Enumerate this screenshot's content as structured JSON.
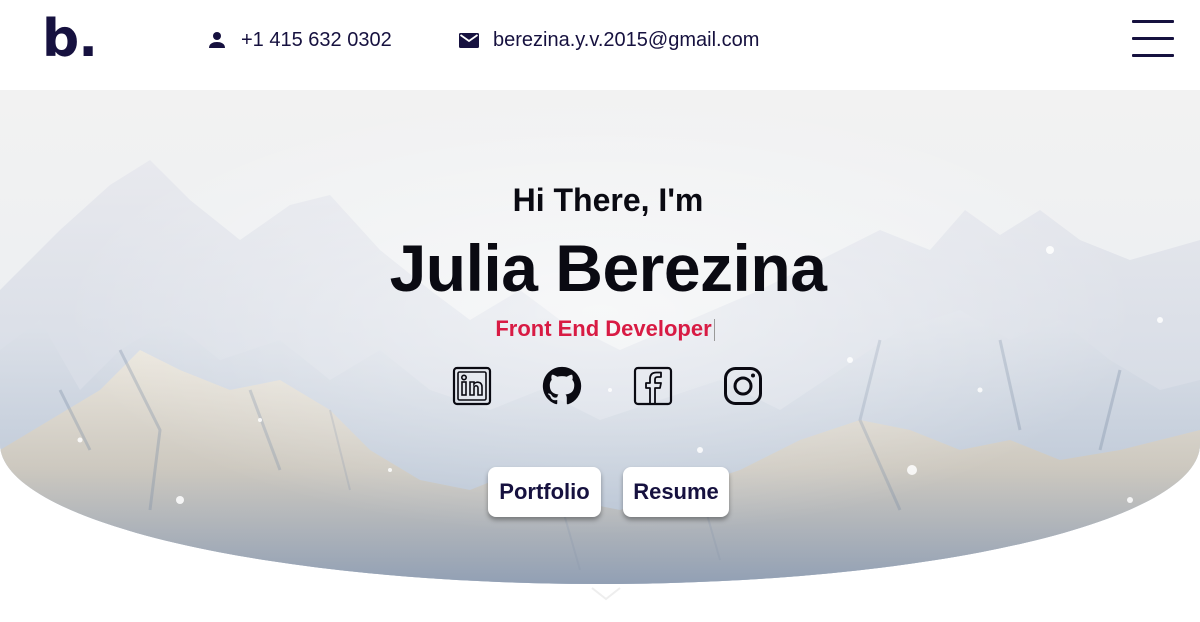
{
  "header": {
    "logo": "b.",
    "phone": {
      "icon": "person-icon",
      "text": "+1 415 632 0302"
    },
    "email": {
      "icon": "mail-icon",
      "text": "berezina.y.v.2015@gmail.com"
    },
    "menu_icon": "hamburger-menu-icon"
  },
  "hero": {
    "greeting": "Hi There, I'm",
    "name": "Julia Berezina",
    "role": "Front End Developer",
    "socials": [
      {
        "name": "LinkedIn",
        "icon": "linkedin-icon"
      },
      {
        "name": "GitHub",
        "icon": "github-icon"
      },
      {
        "name": "Facebook",
        "icon": "facebook-icon"
      },
      {
        "name": "Instagram",
        "icon": "instagram-icon"
      }
    ],
    "buttons": {
      "portfolio": "Portfolio",
      "resume": "Resume"
    },
    "background": "snowy-mountains-image"
  },
  "colors": {
    "brand_navy": "#16113f",
    "accent_red": "#d81b44",
    "text_dark": "#0a0a12"
  }
}
